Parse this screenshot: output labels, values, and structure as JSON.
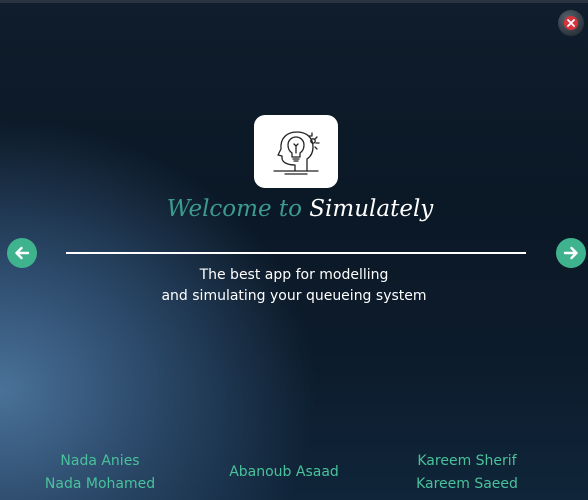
{
  "welcome_text": "Welcome to",
  "app_name": "Simulately",
  "tagline": {
    "line1": "The best app for modelling",
    "line2": "and simulating your queueing system"
  },
  "credits": {
    "left": [
      "Nada Anies",
      "Nada Mohamed"
    ],
    "center": "Abanoub Asaad",
    "right": [
      "Kareem Sherif",
      "Kareem Saeed"
    ]
  },
  "icons": {
    "close": "close-icon",
    "back": "arrow-left-icon",
    "next": "arrow-right-icon",
    "logo": "lightbulb-head-icon"
  },
  "colors": {
    "accent": "#3fb38d",
    "welcome_color": "#3d9a8f",
    "credit_color": "#49c29b",
    "close_red": "#d8333a"
  }
}
